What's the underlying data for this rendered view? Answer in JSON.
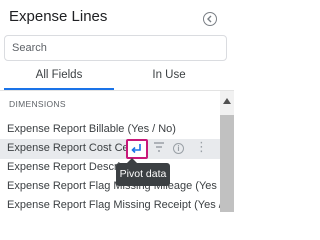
{
  "panel": {
    "title": "Expense Lines"
  },
  "search": {
    "placeholder": "Search"
  },
  "tabs": [
    {
      "label": "All Fields",
      "active": true
    },
    {
      "label": "In Use",
      "active": false
    }
  ],
  "section": {
    "label": "DIMENSIONS"
  },
  "fields": [
    {
      "label": "Expense Report Billable (Yes / No)"
    },
    {
      "label": "Expense Report Cost Center"
    },
    {
      "label": "Expense Report Description"
    },
    {
      "label": "Expense Report Flag Missing Mileage (Yes / ..."
    },
    {
      "label": "Expense Report Flag Missing Receipt (Yes / N..."
    }
  ],
  "row_actions": {
    "pivot_icon": "pivot-icon",
    "filter_icon": "filter-icon",
    "info_icon": "info-icon",
    "more_icon": "more-vert-icon"
  },
  "tooltip": {
    "text": "Pivot data"
  },
  "colors": {
    "accent": "#1a73e8",
    "pivot_highlight_border": "#c8187a",
    "tooltip_bg": "#3c4043",
    "row_highlight": "#e8eaed"
  }
}
